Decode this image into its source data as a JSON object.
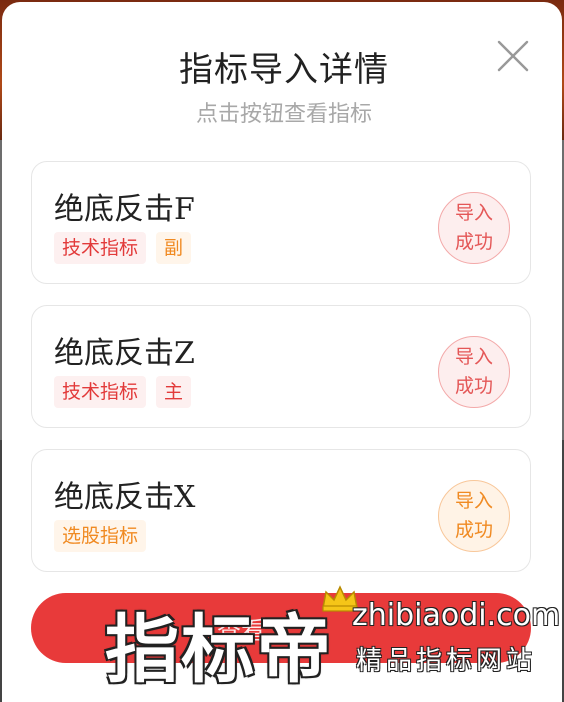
{
  "modal": {
    "title": "指标导入详情",
    "subtitle": "点击按钮查看指标"
  },
  "items": [
    {
      "name": "绝底反击F",
      "tags": [
        {
          "label": "技术指标",
          "color": "red"
        },
        {
          "label": "副",
          "color": "orange"
        }
      ],
      "status": [
        "导入",
        "成功"
      ],
      "status_color": "red"
    },
    {
      "name": "绝底反击Z",
      "tags": [
        {
          "label": "技术指标",
          "color": "red"
        },
        {
          "label": "主",
          "color": "red"
        }
      ],
      "status": [
        "导入",
        "成功"
      ],
      "status_color": "red"
    },
    {
      "name": "绝底反击X",
      "tags": [
        {
          "label": "选股指标",
          "color": "orange"
        }
      ],
      "status": [
        "导入",
        "成功"
      ],
      "status_color": "orange"
    }
  ],
  "button": {
    "label": "查看"
  },
  "watermark": {
    "brand": "指标帝",
    "url": "zhibiaodi.com",
    "slogan": "精品指标网站"
  },
  "colors": {
    "accent_red": "#e83a3a",
    "tag_red": "#e23a3a",
    "tag_orange": "#f08a22"
  }
}
